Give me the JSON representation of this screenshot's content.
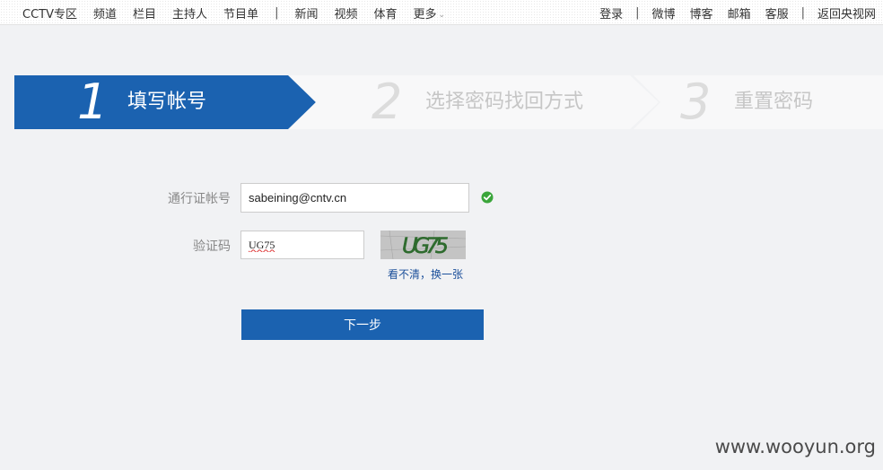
{
  "topnav": {
    "left": [
      "CCTV专区",
      "频道",
      "栏目",
      "主持人",
      "节目单",
      "新闻",
      "视频",
      "体育",
      "更多"
    ],
    "right": [
      "登录",
      "微博",
      "博客",
      "邮箱",
      "客服",
      "返回央视网"
    ],
    "separator": "|"
  },
  "steps": [
    {
      "num": "1",
      "label": "填写帐号",
      "state": "active"
    },
    {
      "num": "2",
      "label": "选择密码找回方式",
      "state": "inactive"
    },
    {
      "num": "3",
      "label": "重置密码",
      "state": "inactive"
    }
  ],
  "form": {
    "account_label": "通行证帐号",
    "account_value": "sabeining@cntv.cn",
    "captcha_label": "验证码",
    "captcha_value": "UG75",
    "captcha_image_text": "UG75",
    "refresh_link": "看不清，换一张",
    "submit": "下一步"
  },
  "colors": {
    "accent": "#1b62b0",
    "success": "#3aa53a",
    "link": "#1b4f9a"
  },
  "watermark": "www.wooyun.org"
}
